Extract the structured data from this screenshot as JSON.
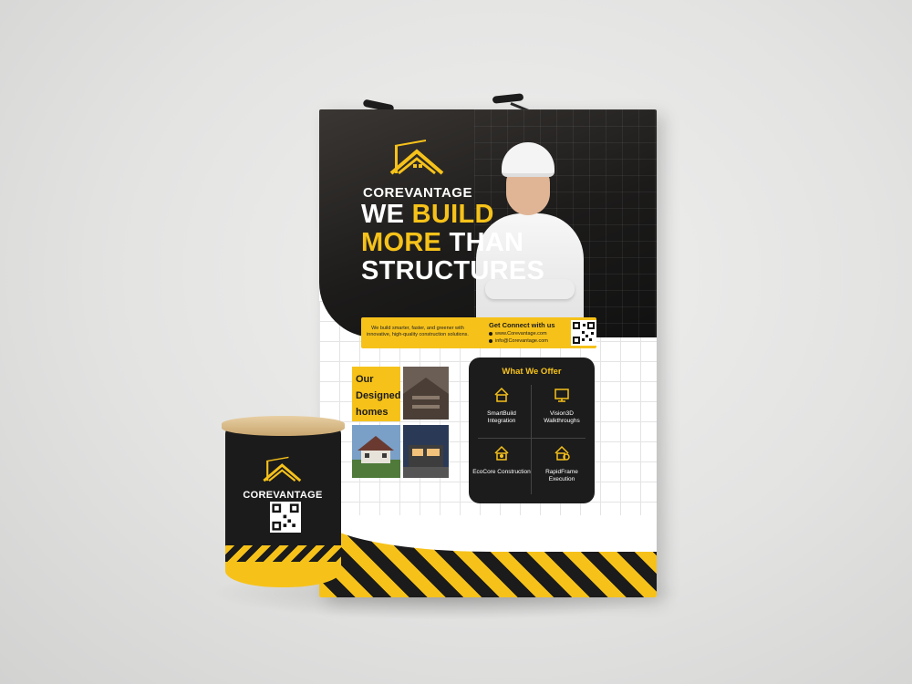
{
  "brand": {
    "name": "COREVANTAGE",
    "accent_color": "#f6c21a",
    "dark_color": "#1b1b1b"
  },
  "headline": {
    "line1_a": "WE ",
    "line1_b": "BUILD",
    "line2_a": "MORE",
    "line2_b": " THAN",
    "line3": "STRUCTURES"
  },
  "info": {
    "description": "We build smarter, faster, and greener with innovative, high-quality construction solutions.",
    "contact_title": "Get Connect with us",
    "website": "www.Corevantage.com",
    "email": "info@Corevantage.com"
  },
  "designed": {
    "line1": "Our",
    "line2": "Designed",
    "line3": "homes"
  },
  "offer": {
    "title": "What We Offer",
    "services": [
      {
        "name": "SmartBuild Integration",
        "icon": "smart-house-icon"
      },
      {
        "name": "Vision3D Walkthroughs",
        "icon": "monitor-3d-icon"
      },
      {
        "name": "EcoCore Construction",
        "icon": "eco-house-icon"
      },
      {
        "name": "RapidFrame Execution",
        "icon": "rapid-frame-icon"
      }
    ]
  },
  "counter": {
    "brand": "COREVANTAGE"
  }
}
